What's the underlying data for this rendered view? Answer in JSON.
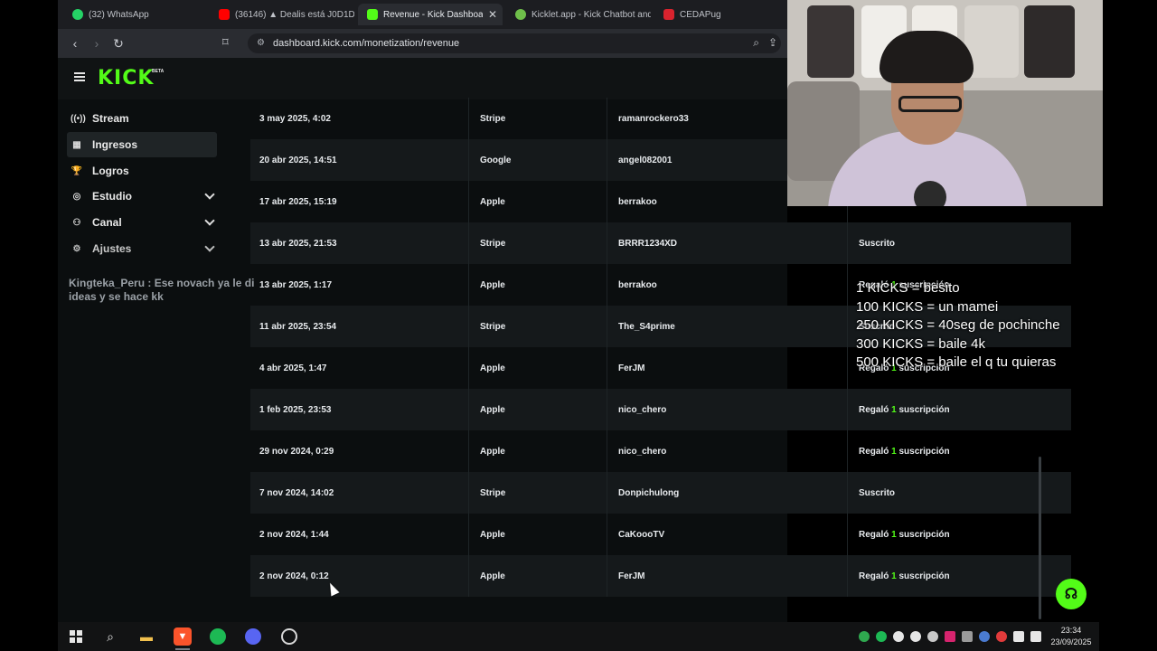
{
  "browser": {
    "tabs": [
      {
        "label": "(32) WhatsApp",
        "icon": "whatsapp-icon",
        "color": "#25d366"
      },
      {
        "label": "(36146) ▲ Dealis está J0D1D",
        "icon": "youtube-icon",
        "color": "#ff0000"
      },
      {
        "label": "Revenue - Kick Dashboard",
        "icon": "kick-icon",
        "color": "#53fc18"
      },
      {
        "label": "Kicklet.app - Kick Chatbot and",
        "icon": "kicklet-icon",
        "color": "#6fbf4a"
      },
      {
        "label": "CEDAPug",
        "icon": "cedapug-icon",
        "color": "#d9232e"
      }
    ],
    "url": "dashboard.kick.com/monetization/revenue"
  },
  "kick": {
    "logo": "KICK",
    "logo_badge": "BETA",
    "sidebar": [
      {
        "label": "Stream",
        "icon": "broadcast-icon"
      },
      {
        "label": "Ingresos",
        "icon": "revenue-icon",
        "active": true
      },
      {
        "label": "Logros",
        "icon": "trophy-icon"
      },
      {
        "label": "Estudio",
        "icon": "studio-icon",
        "expandable": true
      },
      {
        "label": "Canal",
        "icon": "channel-icon",
        "expandable": true
      },
      {
        "label": "Ajustes",
        "icon": "gear-icon",
        "expandable": true
      }
    ],
    "chat_overlay": "Kingteka_Peru : Ese novach ya le di ideas y se hace kk",
    "rows": [
      {
        "date": "3 may 2025, 4:02",
        "method": "Stripe",
        "user": "ramanrockero33",
        "action": "",
        "num": ""
      },
      {
        "date": "20 abr 2025, 14:51",
        "method": "Google",
        "user": "angel082001",
        "action": "",
        "num": ""
      },
      {
        "date": "17 abr 2025, 15:19",
        "method": "Apple",
        "user": "berrakoo",
        "action": "",
        "num": ""
      },
      {
        "date": "13 abr 2025, 21:53",
        "method": "Stripe",
        "user": "BRRR1234XD",
        "action": "Suscrito",
        "num": ""
      },
      {
        "date": "13 abr 2025, 1:17",
        "method": "Apple",
        "user": "berrakoo",
        "action": "Regaló suscripción",
        "num": "1"
      },
      {
        "date": "11 abr 2025, 23:54",
        "method": "Stripe",
        "user": "The_S4prime",
        "action": "Suscrito",
        "num": ""
      },
      {
        "date": "4 abr 2025, 1:47",
        "method": "Apple",
        "user": "FerJM",
        "action": "Regaló suscripción",
        "num": "1"
      },
      {
        "date": "1 feb 2025, 23:53",
        "method": "Apple",
        "user": "nico_chero",
        "action": "Regaló suscripción",
        "num": "1"
      },
      {
        "date": "29 nov 2024, 0:29",
        "method": "Apple",
        "user": "nico_chero",
        "action": "Regaló suscripción",
        "num": "1"
      },
      {
        "date": "7 nov 2024, 14:02",
        "method": "Stripe",
        "user": "Donpichulong",
        "action": "Suscrito",
        "num": ""
      },
      {
        "date": "2 nov 2024, 1:44",
        "method": "Apple",
        "user": "CaKoooTV",
        "action": "Regaló suscripción",
        "num": "1"
      },
      {
        "date": "2 nov 2024, 0:12",
        "method": "Apple",
        "user": "FerJM",
        "action": "Regaló suscripción",
        "num": "1"
      }
    ]
  },
  "stream_overlay": [
    "1 KICKS = besito",
    "100 KICKS = un mamei",
    "250 KICKS = 40seg de pochinche",
    "300 KICKS = baile 4k",
    "500 KICKS = baile el q tu quieras"
  ],
  "taskbar": {
    "time": "23:34",
    "date": "23/09/2025",
    "apps": [
      "windows-icon",
      "search-icon",
      "file-explorer-icon",
      "brave-icon",
      "spotify-icon",
      "discord-icon",
      "obs-icon"
    ]
  }
}
